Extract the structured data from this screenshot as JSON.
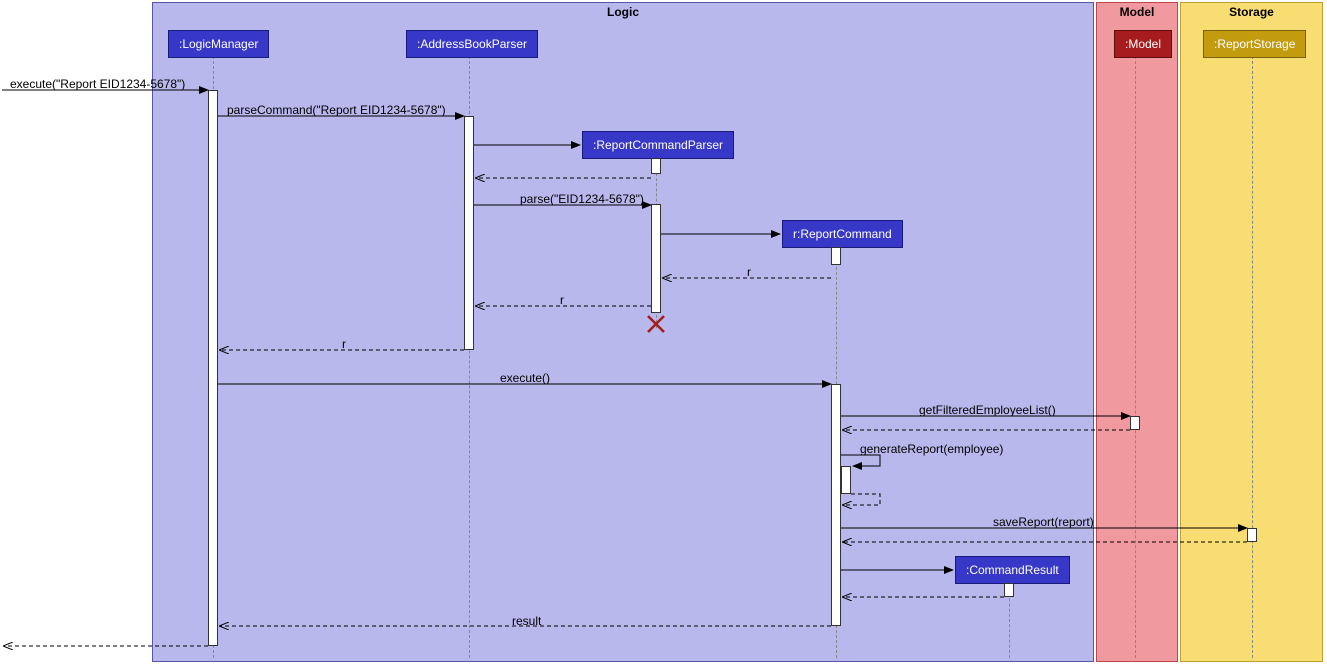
{
  "packages": {
    "logic": {
      "label": "Logic",
      "color": "#B8B8ED",
      "border": "#5555AA"
    },
    "model": {
      "label": "Model",
      "color": "#F0999F",
      "border": "#C0474F"
    },
    "storage": {
      "label": "Storage",
      "color": "#F7DD72",
      "border": "#C0A030"
    }
  },
  "participants": {
    "logicManager": {
      "label": ":LogicManager",
      "bg": "#3737C8",
      "fg": "white",
      "border": "#1A1A7A"
    },
    "addressBookParser": {
      "label": ":AddressBookParser",
      "bg": "#3737C8",
      "fg": "white",
      "border": "#1A1A7A"
    },
    "reportCommandParser": {
      "label": ":ReportCommandParser",
      "bg": "#3737C8",
      "fg": "white",
      "border": "#1A1A7A"
    },
    "reportCommand": {
      "label": "r:ReportCommand",
      "bg": "#3737C8",
      "fg": "white",
      "border": "#1A1A7A"
    },
    "commandResult": {
      "label": ":CommandResult",
      "bg": "#3737C8",
      "fg": "white",
      "border": "#1A1A7A"
    },
    "model": {
      "label": ":Model",
      "bg": "#A61C1C",
      "fg": "white",
      "border": "#5E0E0E"
    },
    "reportStorage": {
      "label": ":ReportStorage",
      "bg": "#C29B0F",
      "fg": "white",
      "border": "#7A600A"
    }
  },
  "messages": {
    "m1": "execute(\"Report EID1234-5678\")",
    "m2": "parseCommand(\"Report EID1234-5678\")",
    "m3": "parse(\"EID1234-5678\")",
    "m4_r1": "r",
    "m5_r2": "r",
    "m6_r3": "r",
    "m7": "execute()",
    "m8": "getFilteredEmployeeList()",
    "m9": "generateReport(employee)",
    "m10": "saveReport(report)",
    "m11": "result"
  }
}
